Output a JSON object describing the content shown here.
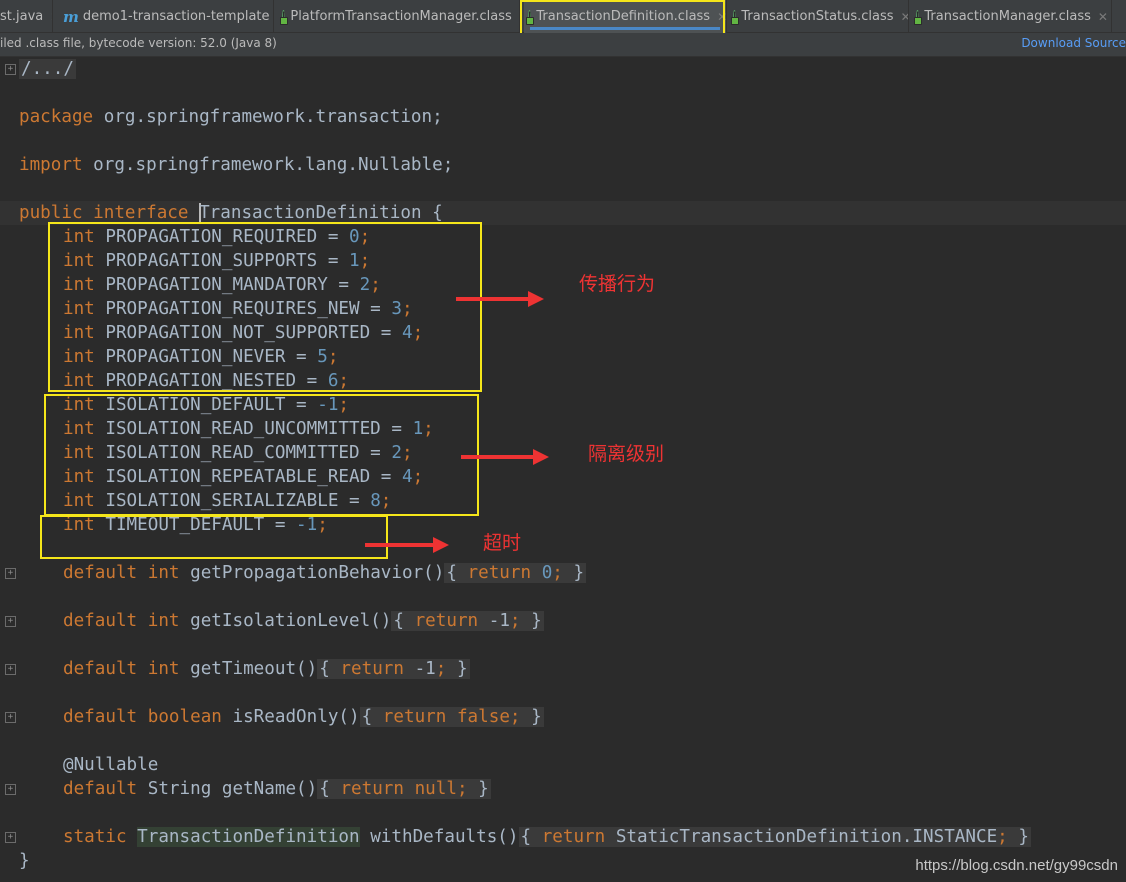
{
  "tabs": [
    {
      "label": "st.java",
      "active": false
    },
    {
      "label": "demo1-transaction-template",
      "active": false
    },
    {
      "label": "PlatformTransactionManager.class",
      "active": false
    },
    {
      "label": "TransactionDefinition.class",
      "active": true
    },
    {
      "label": "TransactionStatus.class",
      "active": false
    },
    {
      "label": "TransactionManager.class",
      "active": false
    }
  ],
  "infobar": {
    "message": "iled .class file, bytecode version: 52.0 (Java 8)",
    "action": "Download Source"
  },
  "code": {
    "header_fold": "/.../",
    "package_kw": "package",
    "package_name": "org.springframework.transaction;",
    "import_kw": "import",
    "import_name": "org.springframework.lang.Nullable;",
    "decl_public": "public",
    "decl_interface": "interface",
    "decl_name": "TransactionDefinition",
    "decl_brace": " {",
    "int_kw": "int",
    "constants": [
      {
        "name": "PROPAGATION_REQUIRED",
        "value": "0"
      },
      {
        "name": "PROPAGATION_SUPPORTS",
        "value": "1"
      },
      {
        "name": "PROPAGATION_MANDATORY",
        "value": "2"
      },
      {
        "name": "PROPAGATION_REQUIRES_NEW",
        "value": "3"
      },
      {
        "name": "PROPAGATION_NOT_SUPPORTED",
        "value": "4"
      },
      {
        "name": "PROPAGATION_NEVER",
        "value": "5"
      },
      {
        "name": "PROPAGATION_NESTED",
        "value": "6"
      },
      {
        "name": "ISOLATION_DEFAULT",
        "value": "-1"
      },
      {
        "name": "ISOLATION_READ_UNCOMMITTED",
        "value": "1"
      },
      {
        "name": "ISOLATION_READ_COMMITTED",
        "value": "2"
      },
      {
        "name": "ISOLATION_REPEATABLE_READ",
        "value": "4"
      },
      {
        "name": "ISOLATION_SERIALIZABLE",
        "value": "8"
      },
      {
        "name": "TIMEOUT_DEFAULT",
        "value": "-1"
      }
    ],
    "methods": [
      {
        "modifier": "default",
        "type": "int",
        "name": "getPropagationBehavior()",
        "ret_kw": "return",
        "ret_val": "0",
        "ret_val_kind": "num"
      },
      {
        "modifier": "default",
        "type": "int",
        "name": "getIsolationLevel()",
        "ret_kw": "return",
        "ret_val": "-1",
        "ret_val_kind": "plain"
      },
      {
        "modifier": "default",
        "type": "int",
        "name": "getTimeout()",
        "ret_kw": "return",
        "ret_val": "-1",
        "ret_val_kind": "plain"
      },
      {
        "modifier": "default",
        "type": "boolean",
        "name": "isReadOnly()",
        "ret_kw": "return",
        "ret_val": "false",
        "ret_val_kind": "kw"
      },
      {
        "modifier": "default",
        "type": "String",
        "name": "getName()",
        "ret_kw": "return",
        "ret_val": "null",
        "ret_val_kind": "kw"
      }
    ],
    "annotation": "@Nullable",
    "static_kw": "static",
    "static_type": "TransactionDefinition",
    "static_method": "withDefaults()",
    "static_ret_kw": "return",
    "static_ret_val": "StaticTransactionDefinition.INSTANCE",
    "closing_brace": "}"
  },
  "annotations": {
    "propagation_label": "传播行为",
    "isolation_label": "隔离级别",
    "timeout_label": "超时"
  },
  "watermark": "https://blog.csdn.net/gy99csdn",
  "colors": {
    "editor_bg": "#2b2b2b",
    "keyword": "#cc7832",
    "number": "#6897bb",
    "text": "#a9b7c6",
    "highlight_box": "#f5e61a",
    "arrow": "#ee3333"
  }
}
